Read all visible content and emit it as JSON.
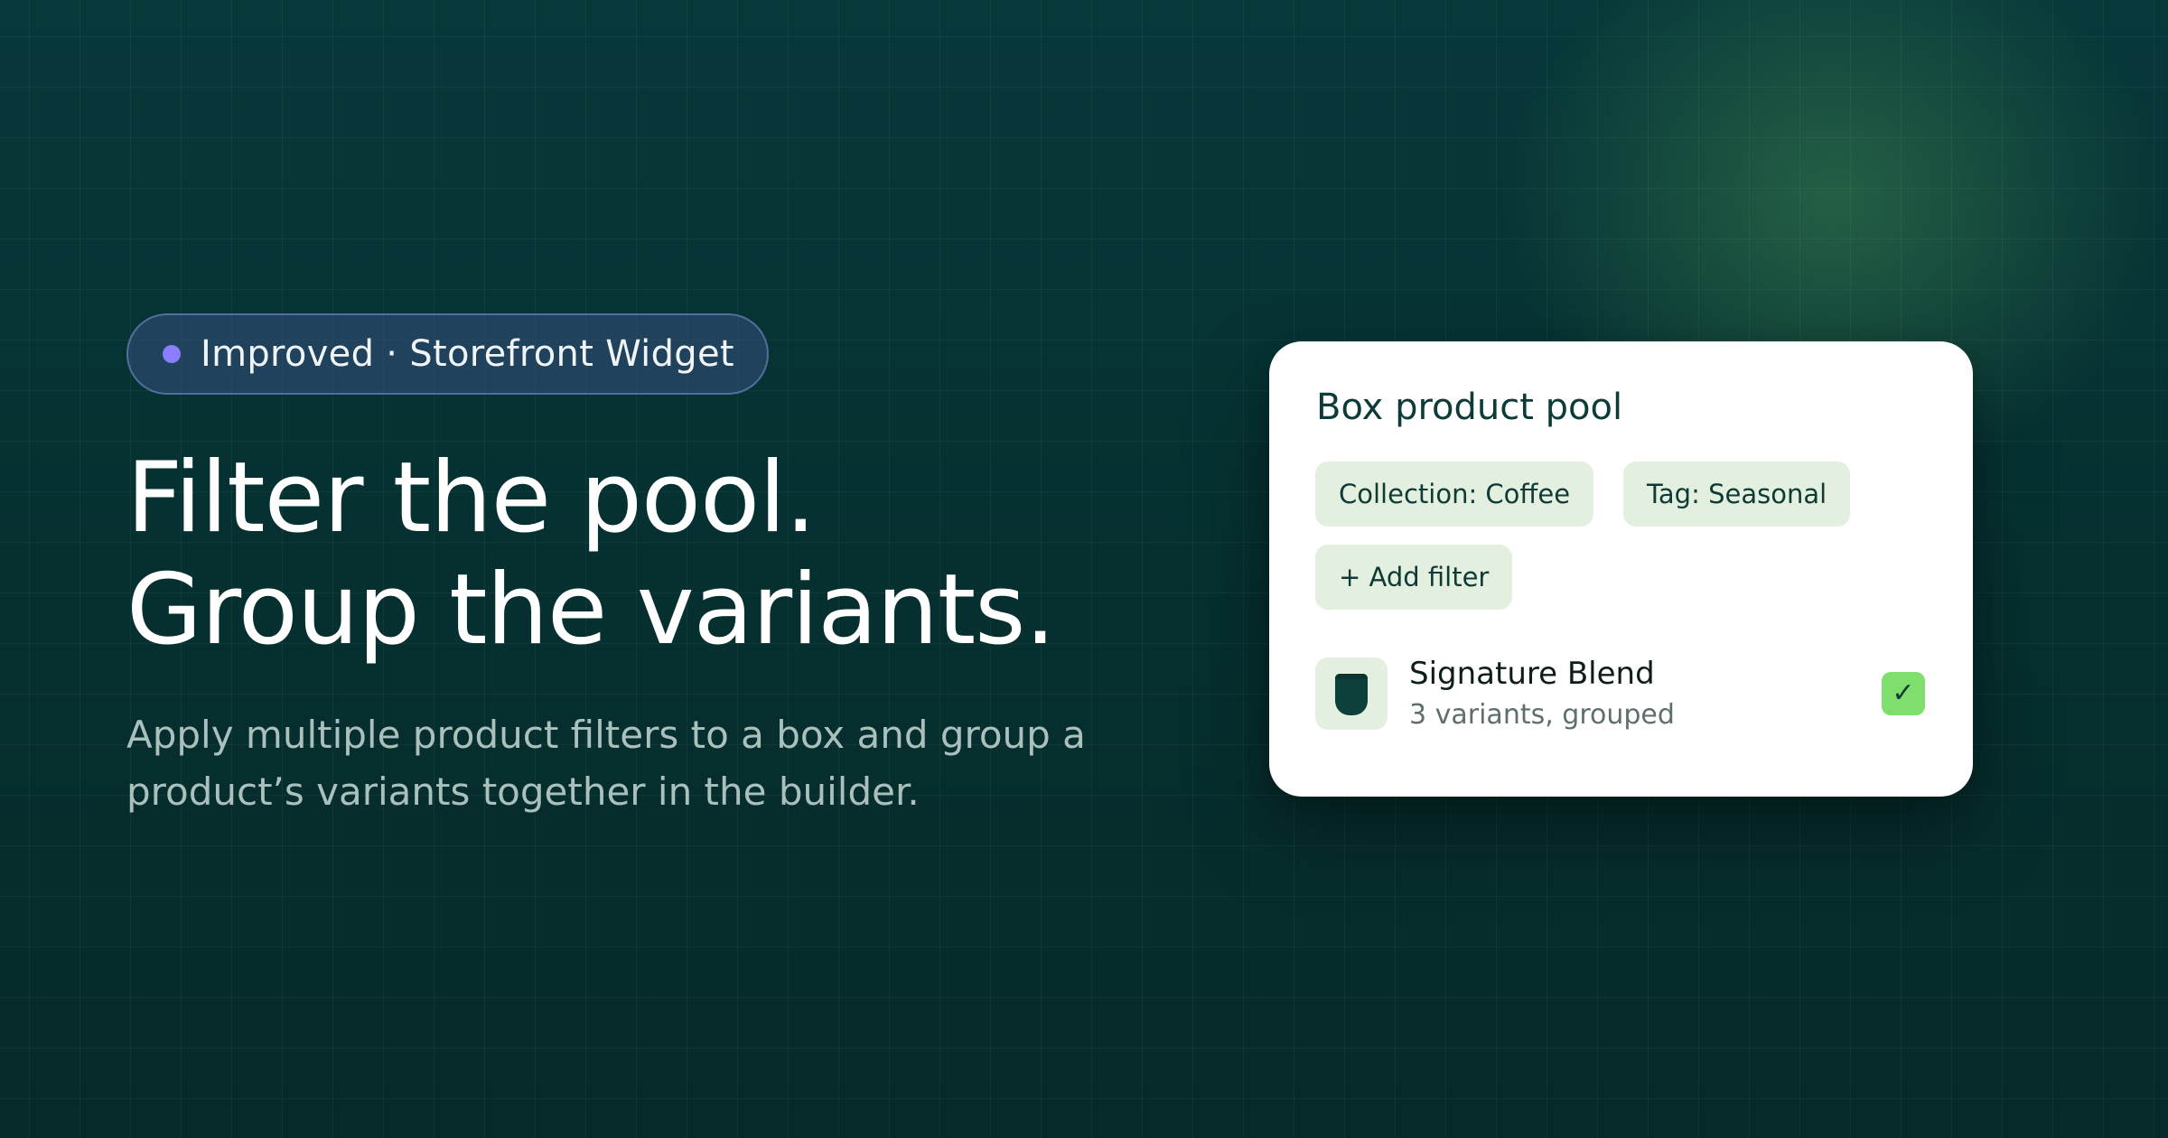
{
  "colors": {
    "badge_dot": "#8b7dff",
    "card_background": "#ffffff",
    "chip_background": "#e3efdf",
    "check_background": "#7ede6e",
    "accent_dark": "#0c3b38"
  },
  "badge": {
    "text": "Improved · Storefront Widget",
    "icon": "dot-icon"
  },
  "headline": {
    "line1": "Filter the pool.",
    "line2": "Group the variants."
  },
  "subtext": "Apply multiple product filters to a box and group a product’s variants together in the builder.",
  "card": {
    "title": "Box product pool",
    "filters": [
      "Collection: Coffee",
      "Tag: Seasonal"
    ],
    "add_filter_label": "+ Add filter",
    "product": {
      "name": "Signature Blend",
      "meta": "3 variants, grouped",
      "thumbnail_icon": "coffee-bag-icon",
      "selected": true,
      "check_icon": "✓"
    }
  }
}
